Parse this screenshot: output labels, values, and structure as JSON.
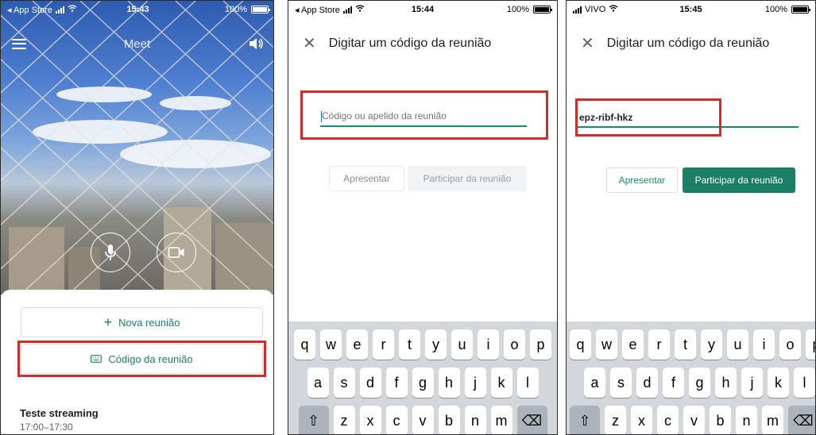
{
  "colors": {
    "brand_green": "#1a7f65",
    "highlight_red": "#d42a2a",
    "input_underline": "#188c6c"
  },
  "screen1": {
    "status": {
      "carrier": "◂ App Store",
      "time": "15:43",
      "battery": "100%",
      "battery_level": 1.0
    },
    "app_title": "Meet",
    "icons": {
      "menu": "hamburger-icon",
      "speaker": "speaker-icon",
      "mic": "mic-icon",
      "video": "video-camera-icon",
      "keyboard": "keyboard-icon"
    },
    "new_meeting_label": "Nova reunião",
    "meeting_code_label": "Código da reunião",
    "event": {
      "title": "Teste streaming",
      "time": "17:00–17:30"
    }
  },
  "screen2": {
    "status": {
      "carrier": "◂ App Store",
      "time": "15:44",
      "battery": "100%",
      "battery_level": 1.0
    },
    "title": "Digitar um código da reunião",
    "input": {
      "value": "",
      "placeholder": "Código ou apelido da reunião"
    },
    "present_label": "Apresentar",
    "join_label": "Participar da reunião"
  },
  "screen3": {
    "status": {
      "carrier": "VIVO",
      "time": "15:45",
      "battery": "100%",
      "battery_level": 1.0
    },
    "title": "Digitar um código da reunião",
    "input": {
      "value": "epz-ribf-hkz",
      "placeholder": ""
    },
    "present_label": "Apresentar",
    "join_label": "Participar da reunião"
  },
  "keyboard": {
    "row1": [
      "q",
      "w",
      "e",
      "r",
      "t",
      "y",
      "u",
      "i",
      "o",
      "p"
    ],
    "row2": [
      "a",
      "s",
      "d",
      "f",
      "g",
      "h",
      "j",
      "k",
      "l"
    ],
    "row3": [
      "z",
      "x",
      "c",
      "v",
      "b",
      "n",
      "m"
    ],
    "shift": "⇧",
    "backspace": "⌫"
  }
}
